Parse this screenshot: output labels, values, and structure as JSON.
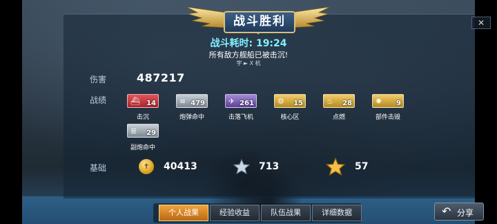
{
  "banner": {
    "title": "战斗胜利"
  },
  "battle": {
    "duration_label": "战斗耗时:",
    "duration_value": "19:24",
    "result_message": "所有敌方舰船已被击沉!",
    "sub_line": "宇 ► X 杭"
  },
  "damage": {
    "label": "伤害",
    "value": "487217"
  },
  "achievements": {
    "label": "战绩",
    "items": [
      {
        "label": "击沉",
        "count": "14",
        "color": "#c93a40",
        "icon": "ship-icon"
      },
      {
        "label": "炮弹命中",
        "count": "479",
        "color": "#a4afb9",
        "icon": "shell-icon"
      },
      {
        "label": "击落飞机",
        "count": "261",
        "color": "#7d5fbd",
        "icon": "plane-icon"
      },
      {
        "label": "核心区",
        "count": "15",
        "color": "#d8ad3c",
        "icon": "core-icon"
      },
      {
        "label": "点燃",
        "count": "28",
        "color": "#d8ad3c",
        "icon": "fire-icon"
      },
      {
        "label": "部件击毁",
        "count": "9",
        "color": "#d8ad3c",
        "icon": "gear-icon"
      },
      {
        "label": "副炮命中",
        "count": "29",
        "color": "#a4afb9",
        "icon": "secondary-gun-icon"
      }
    ]
  },
  "base": {
    "label": "基础",
    "coins": "40413",
    "silver_star": "713",
    "gold_star": "57"
  },
  "tabs": [
    {
      "label": "个人战果",
      "active": true
    },
    {
      "label": "经验收益",
      "active": false
    },
    {
      "label": "队伍战果",
      "active": false
    },
    {
      "label": "详细数据",
      "active": false
    }
  ],
  "share": {
    "label": "分享"
  },
  "close": {
    "label": "✕"
  }
}
